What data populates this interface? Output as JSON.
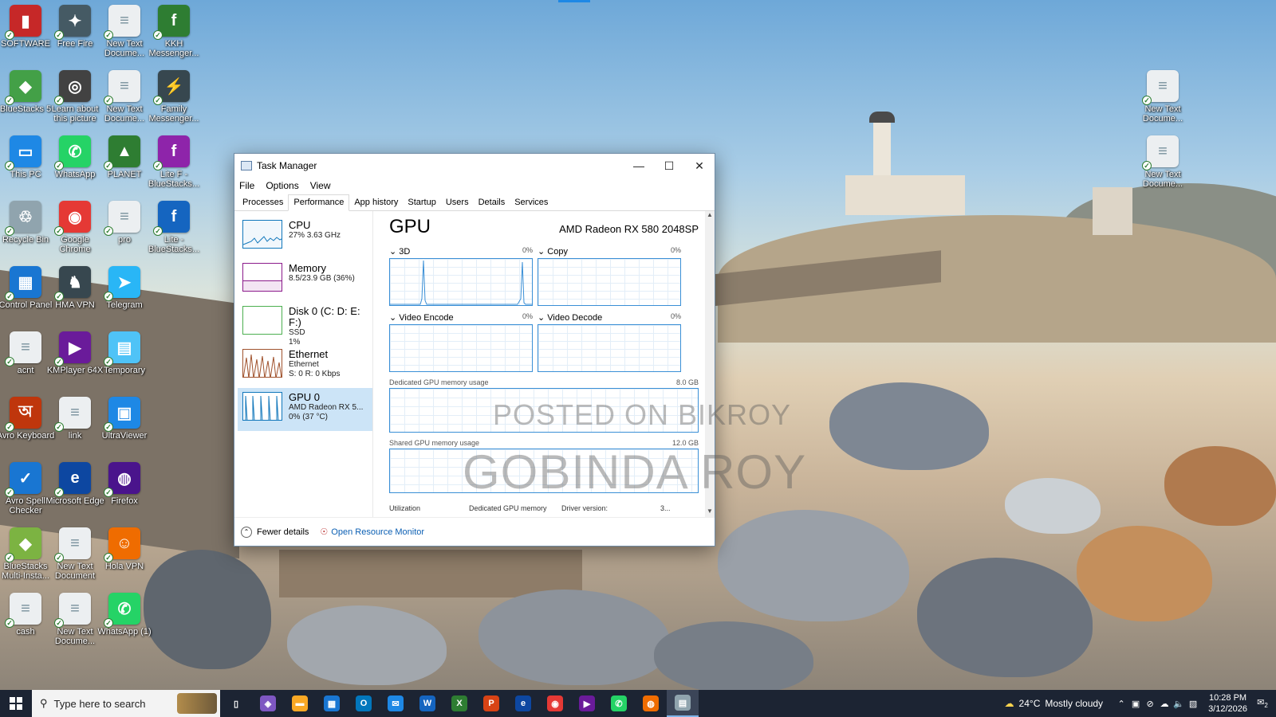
{
  "desktop": {
    "icons": [
      {
        "label": "SOFTWARE",
        "color": "#c62828",
        "glyph": "▮"
      },
      {
        "label": "Free Fire",
        "color": "#455a64",
        "glyph": "✦"
      },
      {
        "label": "New Text Docume...",
        "color": "#eceff1",
        "glyph": "≡"
      },
      {
        "label": "KKH Messenger...",
        "color": "#2e7d32",
        "glyph": "f"
      },
      {
        "label": "BlueStacks 5",
        "color": "#43a047",
        "glyph": "◆"
      },
      {
        "label": "Learn about this picture",
        "color": "#424242",
        "glyph": "◎"
      },
      {
        "label": "New Text Docume...",
        "color": "#eceff1",
        "glyph": "≡"
      },
      {
        "label": "Family Messenger...",
        "color": "#37474f",
        "glyph": "⚡"
      },
      {
        "label": "This PC",
        "color": "#1e88e5",
        "glyph": "▭"
      },
      {
        "label": "WhatsApp",
        "color": "#25d366",
        "glyph": "✆"
      },
      {
        "label": "PLANET",
        "color": "#2e7d32",
        "glyph": "▲"
      },
      {
        "label": "Lite F - BlueStacks...",
        "color": "#8e24aa",
        "glyph": "f"
      },
      {
        "label": "Recycle Bin",
        "color": "#90a4ae",
        "glyph": "♲"
      },
      {
        "label": "Google Chrome",
        "color": "#e53935",
        "glyph": "◉"
      },
      {
        "label": "pro",
        "color": "#eceff1",
        "glyph": "≡"
      },
      {
        "label": "Lite - BlueStacks...",
        "color": "#1565c0",
        "glyph": "f"
      },
      {
        "label": "Control Panel",
        "color": "#1976d2",
        "glyph": "▦"
      },
      {
        "label": "HMA VPN",
        "color": "#37474f",
        "glyph": "♞"
      },
      {
        "label": "Telegram",
        "color": "#29b6f6",
        "glyph": "➤"
      },
      {
        "label": "acnt",
        "color": "#eceff1",
        "glyph": "≡"
      },
      {
        "label": "KMPlayer 64X",
        "color": "#6a1b9a",
        "glyph": "▶"
      },
      {
        "label": "Temporary",
        "color": "#4fc3f7",
        "glyph": "▤"
      },
      {
        "label": "Avro Keyboard",
        "color": "#bf360c",
        "glyph": "অ"
      },
      {
        "label": "link",
        "color": "#eceff1",
        "glyph": "≡"
      },
      {
        "label": "UltraViewer",
        "color": "#1e88e5",
        "glyph": "▣"
      },
      {
        "label": "Avro Spell Checker",
        "color": "#1976d2",
        "glyph": "✓"
      },
      {
        "label": "Microsoft Edge",
        "color": "#0d47a1",
        "glyph": "e"
      },
      {
        "label": "Firefox",
        "color": "#4a148c",
        "glyph": "◍"
      },
      {
        "label": "BlueStacks Multi-Insta...",
        "color": "#7cb342",
        "glyph": "◆"
      },
      {
        "label": "New Text Document",
        "color": "#eceff1",
        "glyph": "≡"
      },
      {
        "label": "Hola VPN",
        "color": "#ef6c00",
        "glyph": "☺"
      },
      {
        "label": "cash",
        "color": "#eceff1",
        "glyph": "≡"
      },
      {
        "label": "New Text Docume...",
        "color": "#eceff1",
        "glyph": "≡"
      },
      {
        "label": "WhatsApp (1)",
        "color": "#25d366",
        "glyph": "✆"
      },
      {
        "label": "New Text Docume...",
        "color": "#eceff1",
        "glyph": "≡"
      },
      {
        "label": "New Text Docume...",
        "color": "#eceff1",
        "glyph": "≡"
      }
    ]
  },
  "taskmanager": {
    "title": "Task Manager",
    "menu": [
      "File",
      "Options",
      "View"
    ],
    "tabs": [
      "Processes",
      "Performance",
      "App history",
      "Startup",
      "Users",
      "Details",
      "Services"
    ],
    "active_tab": "Performance",
    "sidebar": [
      {
        "name": "CPU",
        "sub1": "27% 3.63 GHz",
        "sub2": "",
        "sub3": ""
      },
      {
        "name": "Memory",
        "sub1": "8.5/23.9 GB (36%)",
        "sub2": "",
        "sub3": ""
      },
      {
        "name": "Disk 0 (C: D: E: F:)",
        "sub1": "SSD",
        "sub2": "1%",
        "sub3": ""
      },
      {
        "name": "Ethernet",
        "sub1": "Ethernet",
        "sub2": "S: 0 R: 0 Kbps",
        "sub3": ""
      },
      {
        "name": "GPU 0",
        "sub1": "AMD Radeon RX 5...",
        "sub2": "0% (37 °C)",
        "sub3": ""
      }
    ],
    "gpu": {
      "title": "GPU",
      "model": "AMD Radeon RX 580 2048SP",
      "engines": [
        {
          "label": "3D",
          "pct": "0%"
        },
        {
          "label": "Copy",
          "pct": "0%"
        },
        {
          "label": "Video Encode",
          "pct": "0%"
        },
        {
          "label": "Video Decode",
          "pct": "0%"
        }
      ],
      "dedicated_label": "Dedicated GPU memory usage",
      "dedicated_max": "8.0 GB",
      "shared_label": "Shared GPU memory usage",
      "shared_max": "12.0 GB",
      "stats": [
        "Utilization",
        "Dedicated GPU memory",
        "Driver version:",
        "3..."
      ]
    },
    "footer": {
      "fewer": "Fewer details",
      "resmon": "Open Resource Monitor"
    }
  },
  "watermark": {
    "line1": "POSTED ON BIKROY",
    "line2": "GOBINDA ROY"
  },
  "taskbar": {
    "search_placeholder": "Type here to search",
    "weather_temp": "24°C",
    "weather_text": "Mostly cloudy",
    "time": "10:28 PM",
    "date": "3/12/2026",
    "notification_count": "2",
    "apps": [
      {
        "name": "task-view",
        "color": "#ffffff",
        "glyph": "▯"
      },
      {
        "name": "copilot",
        "color": "#7e57c2",
        "glyph": "◈"
      },
      {
        "name": "file-explorer",
        "color": "#f9a825",
        "glyph": "▬"
      },
      {
        "name": "microsoft-store",
        "color": "#1976d2",
        "glyph": "▦"
      },
      {
        "name": "outlook",
        "color": "#0277bd",
        "glyph": "O"
      },
      {
        "name": "mail",
        "color": "#1e88e5",
        "glyph": "✉"
      },
      {
        "name": "word",
        "color": "#1565c0",
        "glyph": "W"
      },
      {
        "name": "excel",
        "color": "#2e7d32",
        "glyph": "X"
      },
      {
        "name": "powerpoint",
        "color": "#d84315",
        "glyph": "P"
      },
      {
        "name": "edge",
        "color": "#0d47a1",
        "glyph": "e"
      },
      {
        "name": "chrome",
        "color": "#e53935",
        "glyph": "◉"
      },
      {
        "name": "kmplayer",
        "color": "#6a1b9a",
        "glyph": "▶"
      },
      {
        "name": "whatsapp",
        "color": "#25d366",
        "glyph": "✆"
      },
      {
        "name": "firefox",
        "color": "#ef6c00",
        "glyph": "◍"
      },
      {
        "name": "task-manager",
        "color": "#90a4ae",
        "glyph": "▤"
      }
    ]
  }
}
